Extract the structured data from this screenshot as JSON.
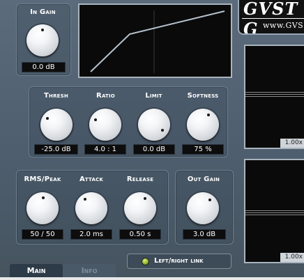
{
  "brand": {
    "logo": "GVST G",
    "url": "www.GVS"
  },
  "in_gain": {
    "label": "In Gain",
    "value": "0.0 dB"
  },
  "compressor": {
    "thresh": {
      "label": "Thresh",
      "value": "-25.0 dB"
    },
    "ratio": {
      "label": "Ratio",
      "value": "4.0 : 1"
    },
    "limit": {
      "label": "Limit",
      "value": "0.0 dB"
    },
    "softness": {
      "label": "Softness",
      "value": "75 %"
    }
  },
  "dynamics": {
    "rms_peak": {
      "label": "RMS/Peak",
      "value": "50 / 50"
    },
    "attack": {
      "label": "Attack",
      "value": "2.0 ms"
    },
    "release": {
      "label": "Release",
      "value": "0.50 s"
    }
  },
  "out_gain": {
    "label": "Out Gain",
    "value": "3.0 dB"
  },
  "meters": [
    {
      "zoom": "1.00x"
    },
    {
      "zoom": "1.00x"
    }
  ],
  "link": {
    "label": "Left/right link",
    "led_color": "#a7c43a"
  },
  "tabs": [
    {
      "label": "Main",
      "active": true
    },
    {
      "label": "Info",
      "active": false
    }
  ],
  "colors": {
    "panel_bg": "#55657a",
    "display_bg": "#0a0a0a",
    "curve": "#b7c3cf"
  }
}
